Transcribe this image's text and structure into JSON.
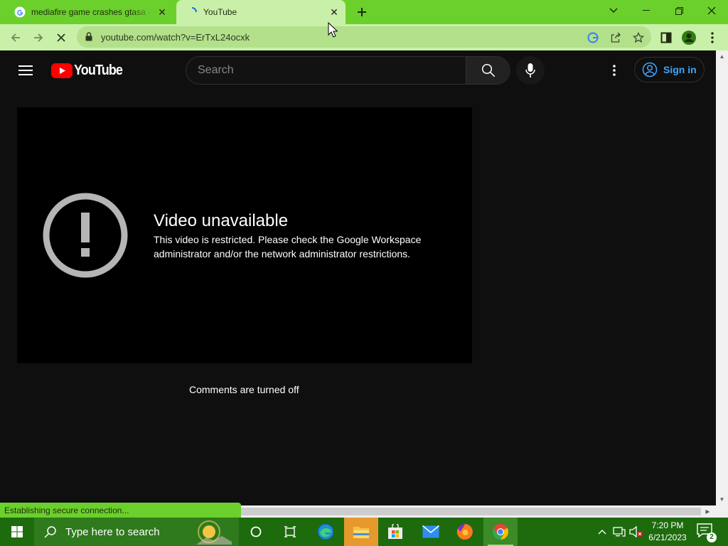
{
  "browser": {
    "tabs": [
      {
        "title": "mediafire game crashes gtasa - G",
        "favicon": "google-g-icon",
        "active": false
      },
      {
        "title": "YouTube",
        "favicon": "loading-spinner-icon",
        "active": true
      }
    ],
    "url": "youtube.com/watch?v=ErTxL24ocxk",
    "status": "Establishing secure connection...",
    "theme_colors": {
      "frame": "#6bd02c",
      "toolbar": "#c9f0a8",
      "omnibox": "#b3e08b"
    }
  },
  "youtube": {
    "logo_text": "YouTube",
    "search_placeholder": "Search",
    "sign_in_label": "Sign in",
    "player": {
      "error_title": "Video unavailable",
      "error_message": "This video is restricted. Please check the Google Workspace administrator and/or the network administrator restrictions."
    },
    "comments_status": "Comments are turned off",
    "accent_color": "#3ea6ff"
  },
  "taskbar": {
    "search_placeholder": "Type here to search",
    "apps": [
      "cortana-icon",
      "task-view-icon",
      "edge-icon",
      "file-explorer-icon",
      "microsoft-store-icon",
      "mail-icon",
      "firefox-icon",
      "chrome-icon"
    ],
    "time": "7:20 PM",
    "date": "6/21/2023",
    "notification_count": "2",
    "color": "#1e6b0e"
  }
}
